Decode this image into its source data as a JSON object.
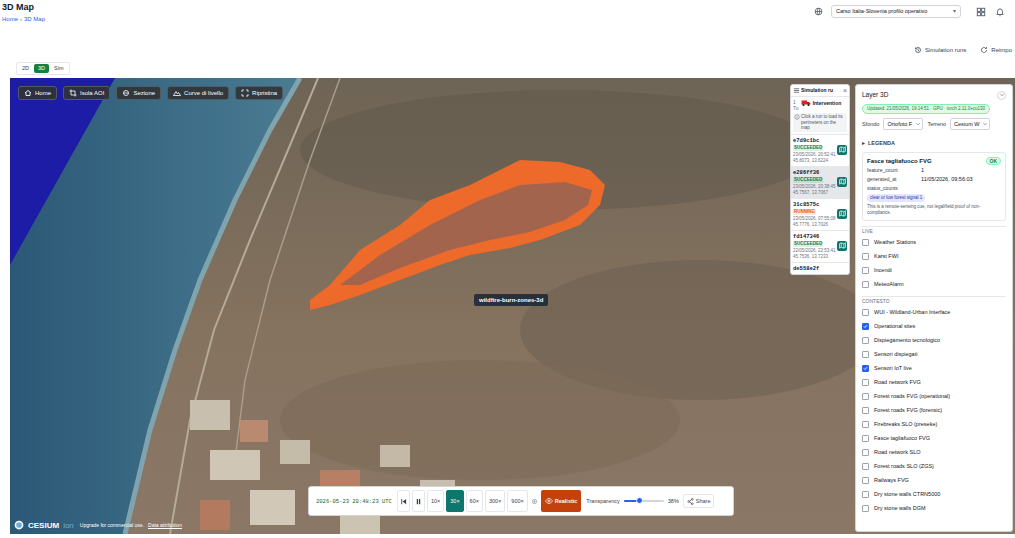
{
  "header": {
    "title": "3D Map",
    "breadcrumb": {
      "home": "Home",
      "separator": "›",
      "current": "3D Map"
    },
    "profile": {
      "value": "Carso Italia-Slovenia profilo operativo",
      "caret": "▾"
    }
  },
  "actions": [
    {
      "label": "Simulation runs"
    },
    {
      "label": "Reimpo"
    }
  ],
  "view_tabs": [
    {
      "label": "2D",
      "selected": false
    },
    {
      "label": "3D",
      "selected": true
    },
    {
      "label": "Sim",
      "selected": false
    }
  ],
  "map": {
    "toolbar": [
      {
        "label": "Home"
      },
      {
        "label": "Isola AOI"
      },
      {
        "label": "Sezione"
      },
      {
        "label": "Curve di livello"
      },
      {
        "label": "Ripristina"
      }
    ],
    "tooltip": "wildfire-burn-zones-3d",
    "attribution": {
      "brand": "CESIUM",
      "brand_suffix": "ion",
      "notice": "Upgrade for commercial use.",
      "link": "Data attribution"
    }
  },
  "timeline": {
    "clock": "2026-05-23 20:48:23 UTC",
    "speeds": [
      {
        "label": "10×",
        "selected": false
      },
      {
        "label": "30×",
        "selected": true
      },
      {
        "label": "60×",
        "selected": false
      },
      {
        "label": "300×",
        "selected": false
      },
      {
        "label": "900×",
        "selected": false
      }
    ],
    "mode": "Realistic",
    "transparency": {
      "label": "Transparency",
      "level": 0.38,
      "reading": "38%"
    },
    "share": "Share"
  },
  "simulation_panel": {
    "title": "Simulation ru",
    "close": "×",
    "count": "1",
    "tab_prefix": "Tu",
    "intervention": "Intervention",
    "hint": "Click a run to load its perimeters on the map",
    "runs": [
      {
        "id": "e7d9c1bc",
        "status": "SUCCEEDED",
        "color": "#15803d",
        "time": "23/05/2026, 20:52:41",
        "coords": "45.8073, 13.6224",
        "selected": false
      },
      {
        "id": "e286ff36",
        "status": "SUCCEEDED",
        "color": "#15803d",
        "time": "23/05/2026, 20:38:45",
        "coords": "45.7567, 13.7067",
        "selected": true
      },
      {
        "id": "31c8575c",
        "status": "RUNNING",
        "color": "#ea580c",
        "time": "23/05/2026, 07:55:08",
        "coords": "45.7776, 13.7026",
        "selected": false
      },
      {
        "id": "fd147346",
        "status": "SUCCEEDED",
        "color": "#15803d",
        "time": "22/05/2026, 22:53:41",
        "coords": "45.7536, 13.7233",
        "selected": false
      },
      {
        "id": "de558e2f",
        "status": "",
        "color": "#15803d",
        "time": "",
        "coords": "",
        "selected": false
      }
    ]
  },
  "layer_panel": {
    "title": "Layer 3D",
    "status": "Updated: 21/05/2026, 19:14:51 · GPU · torch 2.11.0+cu130",
    "background": {
      "label": "Sfondo",
      "value": "Ortofoto F"
    },
    "terrain": {
      "label": "Terreno",
      "value": "Cesium W"
    },
    "legend": {
      "toggle": "▸",
      "title": "LEGENDA"
    },
    "legend_card": {
      "title": "Fasce tagliafuoco FVG",
      "badge": "OK",
      "fields": [
        {
          "key": "feature_count",
          "value": "1"
        },
        {
          "key": "generated_at",
          "value": "11/05/2026, 09:56:03"
        }
      ],
      "status_counts_label": "status_counts",
      "status_pill": "clear or low forest signal 1",
      "note": "This is a remote-sensing cue, not legal/field proof of non-compliance."
    },
    "groups": [
      {
        "title": "LIVE",
        "layers": [
          {
            "label": "Weather Stations",
            "checked": false
          },
          {
            "label": "Karst FWI",
            "checked": false
          },
          {
            "label": "Incendi",
            "checked": false
          },
          {
            "label": "MeteoAlarm",
            "checked": false
          }
        ]
      },
      {
        "title": "CONTESTO",
        "layers": [
          {
            "label": "WUI - Wildland-Urban Interface",
            "checked": false
          },
          {
            "label": "Operational sites",
            "checked": true
          },
          {
            "label": "Dispiegamento tecnologico",
            "checked": false
          },
          {
            "label": "Sensori dispiegati",
            "checked": false
          },
          {
            "label": "Sensori IoT live",
            "checked": true
          },
          {
            "label": "Road network FVG",
            "checked": false
          },
          {
            "label": "Forest roads FVG (operational)",
            "checked": false
          },
          {
            "label": "Forest roads FVG (forensic)",
            "checked": false
          },
          {
            "label": "Firebreaks SLO (preseke)",
            "checked": false
          },
          {
            "label": "Fasce tagliafuoco FVG",
            "checked": false
          },
          {
            "label": "Road network SLO",
            "checked": false
          },
          {
            "label": "Forest roads SLO (ZGS)",
            "checked": false
          },
          {
            "label": "Railways FVG",
            "checked": false
          },
          {
            "label": "Dry stone walls CTRN5000",
            "checked": false
          },
          {
            "label": "Dry stone walls DGM",
            "checked": false
          }
        ]
      }
    ]
  }
}
